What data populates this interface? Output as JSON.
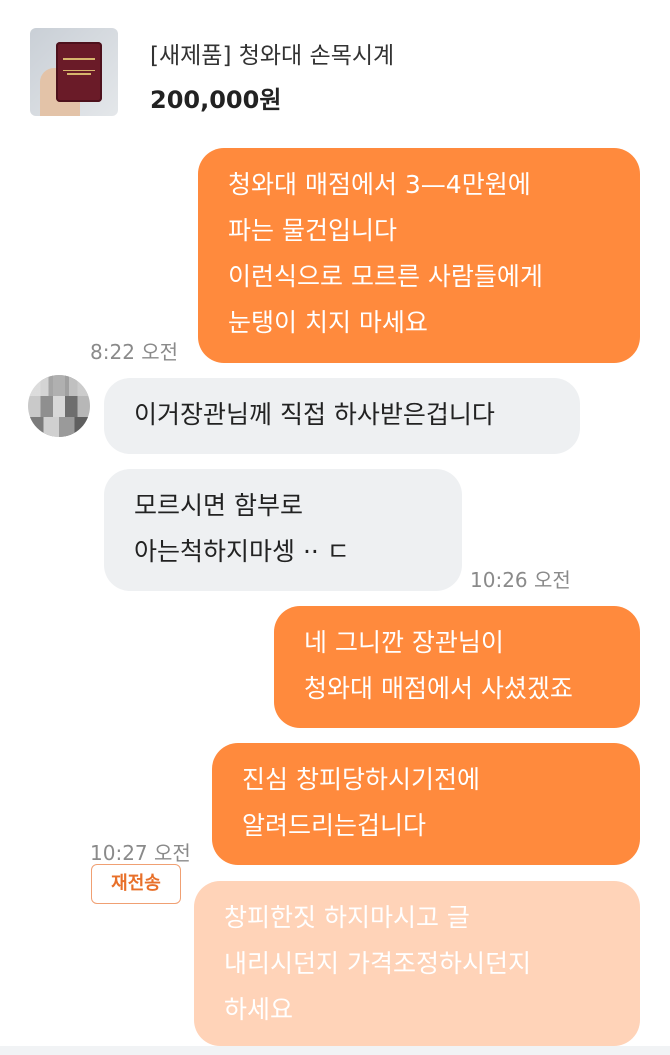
{
  "product": {
    "title": "[새제품] 청와대 손목시계",
    "price": "200,000원",
    "thumbnail_icon": "watch-box-photo"
  },
  "messages": [
    {
      "sender": "me",
      "text": "청와대 매점에서 3—4만원에\n파는 물건입니다\n이런식으로 모르른 사람들에게\n눈탱이 치지 마세요",
      "time": "8:22 오전"
    },
    {
      "sender": "other",
      "text": "이거장관님께 직접 하사받은겁니다"
    },
    {
      "sender": "other",
      "text": "모르시면 함부로\n아는척하지마셍 ·· ㄷ",
      "time": "10:26 오전"
    },
    {
      "sender": "me",
      "text": "네 그니깐 장관님이\n청와대 매점에서 사셨겠죠"
    },
    {
      "sender": "me",
      "text": "진심 창피당하시기전에\n알려드리는겁니다",
      "time": "10:27 오전"
    },
    {
      "sender": "me",
      "status": "failed",
      "text": "창피한짓 하지마시고 글\n내리시던지 가격조정하시던지\n하세요",
      "resend_label": "재전송"
    }
  ],
  "colors": {
    "my_bubble": "#ff8a3d",
    "failed_bubble": "#ffd3b8",
    "their_bubble": "#eef0f2",
    "resend_accent": "#e8702a"
  }
}
